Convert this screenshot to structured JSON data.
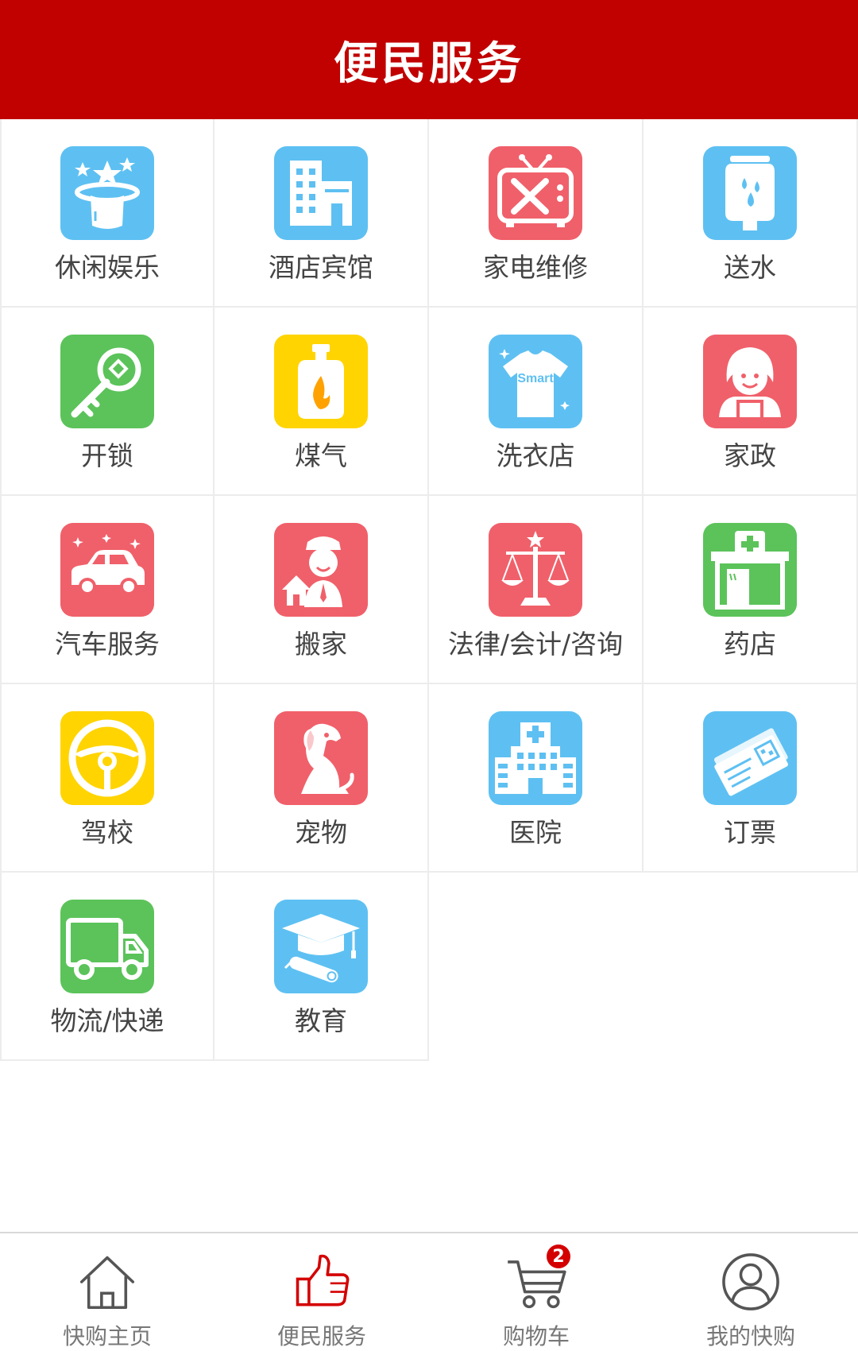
{
  "header": {
    "title": "便民服务"
  },
  "colors": {
    "header_bg": "#c10000",
    "blue": "#5ec0f2",
    "red": "#f0606a",
    "green": "#5bc35a",
    "yellow": "#ffd400",
    "badge": "#d40000"
  },
  "services": [
    {
      "label": "休闲娱乐",
      "icon": "magic-hat-icon",
      "color": "blue"
    },
    {
      "label": "酒店宾馆",
      "icon": "hotel-building-icon",
      "color": "blue"
    },
    {
      "label": "家电维修",
      "icon": "tv-repair-icon",
      "color": "red"
    },
    {
      "label": "送水",
      "icon": "water-bottle-icon",
      "color": "blue"
    },
    {
      "label": "开锁",
      "icon": "key-icon",
      "color": "green"
    },
    {
      "label": "煤气",
      "icon": "gas-cylinder-icon",
      "color": "yellow"
    },
    {
      "label": "洗衣店",
      "icon": "shirt-icon",
      "color": "blue",
      "icon_text": "Smart"
    },
    {
      "label": "家政",
      "icon": "housekeeper-icon",
      "color": "red"
    },
    {
      "label": "汽车服务",
      "icon": "car-icon",
      "color": "red"
    },
    {
      "label": "搬家",
      "icon": "mover-icon",
      "color": "red"
    },
    {
      "label": "法律/会计/咨询",
      "icon": "scales-icon",
      "color": "red"
    },
    {
      "label": "药店",
      "icon": "pharmacy-icon",
      "color": "green"
    },
    {
      "label": "驾校",
      "icon": "steering-wheel-icon",
      "color": "yellow"
    },
    {
      "label": "宠物",
      "icon": "dog-icon",
      "color": "red"
    },
    {
      "label": "医院",
      "icon": "hospital-icon",
      "color": "blue"
    },
    {
      "label": "订票",
      "icon": "ticket-icon",
      "color": "blue"
    },
    {
      "label": "物流/快递",
      "icon": "truck-icon",
      "color": "green"
    },
    {
      "label": "教育",
      "icon": "graduation-cap-icon",
      "color": "blue"
    }
  ],
  "bottom_nav": {
    "items": [
      {
        "label": "快购主页",
        "icon": "home-icon"
      },
      {
        "label": "便民服务",
        "icon": "thumbs-up-icon",
        "active": true
      },
      {
        "label": "购物车",
        "icon": "cart-icon",
        "badge": "2"
      },
      {
        "label": "我的快购",
        "icon": "user-icon"
      }
    ]
  }
}
